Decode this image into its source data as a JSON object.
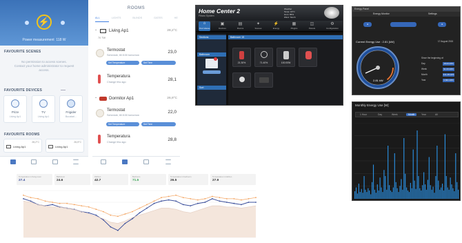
{
  "phone_home": {
    "power_label": "Power measurement",
    "power_value": "118 W",
    "favourite_scenes": "FAVOURITE SCENES",
    "no_permission_1": "No permission to access scenes.",
    "no_permission_2": "Contact your home administrator to request",
    "no_permission_3": "access.",
    "favourite_devices": "FAVOURITE DEVICES",
    "devices": [
      {
        "name": "Prize",
        "room": "Living Ap1"
      },
      {
        "name": "TV",
        "room": "Living Ap1"
      },
      {
        "name": "Frigider",
        "room": "Bucatari..."
      }
    ],
    "favourite_rooms": "FAVOURITE ROOMS",
    "rooms": [
      {
        "name": "Living Ap1",
        "temp": "28,2°C"
      },
      {
        "name": "Living Ap1",
        "temp": "26,5°C"
      }
    ]
  },
  "phone_rooms": {
    "title": "ROOMS",
    "tabs": [
      "ALL",
      "LIGHTS",
      "BLINDS",
      "GATES",
      "HE"
    ],
    "room1": {
      "name": "Living Ap1",
      "temp": "28,2°C",
      "power": "70 TW"
    },
    "device1": {
      "name": "Termostat",
      "sub": "Schedule, till 8:00 tomorrow",
      "value": "23,0",
      "btn1": "Set Temperature",
      "btn2": "Set Time"
    },
    "device2": {
      "name": "Temperatura",
      "sub": "Change few ago",
      "value": "28,1"
    },
    "room2": {
      "name": "Dormitor Ap1",
      "temp": "26,9°C"
    },
    "device3": {
      "name": "Termostat",
      "sub": "Schedule, till 8:00 tomorrow",
      "value": "22,0",
      "btn1": "Set Temperature",
      "btn2": "Set Time"
    },
    "device4": {
      "name": "Temperatura",
      "sub": "Change few ago",
      "value": "28,8"
    }
  },
  "home_center": {
    "title": "Home Center 2",
    "subtitle": "Fibaro System",
    "weather": [
      "Weather",
      "Temp: 16°C",
      "Hum: 86%",
      "Wind: 7km/h"
    ],
    "nav": [
      "Your House",
      "Devices",
      "Rooms",
      "Scenes",
      "Energy",
      "Plugins",
      "Panels",
      "Configuration"
    ],
    "left_items": [
      "Sections",
      "Bathroom",
      "Sort"
    ],
    "section_title": "Bathroom 15",
    "tiles": [
      {
        "label": "21.30%"
      },
      {
        "label": "71.40%"
      },
      {
        "label": "100.00W"
      },
      {
        "label": ""
      },
      {
        "label": ""
      },
      {
        "label": ""
      }
    ]
  },
  "energy": {
    "header": "Energy Panel",
    "tabs": [
      "Energy Monitor",
      "Settings"
    ],
    "current_label": "Current Energy Use : 2.81 [kW]",
    "date": "17 August 2015",
    "since_label": "Since the beginning of:",
    "rows": [
      {
        "name": "Day",
        "value": "18.03 kWh"
      },
      {
        "name": "Week",
        "value": "91.63 kWh"
      },
      {
        "name": "Month",
        "value": "311.28 kWh"
      },
      {
        "name": "Year",
        "value": "2,601 kWh"
      }
    ],
    "gauge_value": "2.81",
    "gauge_unit": "kW"
  },
  "monthly": {
    "title": "Monthly Energy Use [W]",
    "tabs": [
      "1 Hour",
      "Day",
      "Week",
      "Month",
      "Year",
      "All"
    ],
    "active_tab": "Month"
  },
  "line_chart": {
    "stats": [
      {
        "name": "Temperature in living room",
        "value": "27.4"
      },
      {
        "name": "Bathroom",
        "value": "24.6"
      },
      {
        "name": "Kitchen",
        "value": "42.7"
      },
      {
        "name": "Bedroom",
        "value": "71.5"
      },
      {
        "name": "Temperature in bedroom",
        "value": "26.5"
      },
      {
        "name": "Temperature in kitchen",
        "value": "27.9"
      }
    ]
  },
  "chart_data": [
    {
      "type": "line",
      "series": [
        {
          "values": [
            33,
            31,
            28,
            27,
            28,
            26,
            25,
            24,
            22,
            21,
            19,
            15,
            9,
            6,
            12,
            16,
            21,
            25,
            29,
            31,
            32,
            31,
            28,
            27,
            29,
            30,
            33,
            31,
            30,
            29,
            28,
            30,
            30
          ]
        },
        {
          "values": [
            36,
            34,
            33,
            31,
            30,
            29,
            29,
            28,
            27,
            26,
            24,
            22,
            19,
            18,
            20,
            22,
            25,
            28,
            31,
            34,
            35,
            36,
            34,
            33,
            32,
            33,
            35,
            34,
            33,
            33,
            32,
            33,
            34
          ]
        },
        {
          "values": [
            31,
            30,
            28,
            27,
            26,
            26,
            25,
            24,
            22,
            20,
            18,
            16,
            13,
            12,
            14,
            17,
            19,
            21,
            23,
            25,
            25,
            24,
            22,
            21,
            23,
            25,
            27,
            27,
            26,
            26,
            25,
            26,
            27
          ]
        }
      ],
      "ylim": [
        0,
        40
      ],
      "colors": [
        "#3b4f9b",
        "#f4a460",
        "#e5cfc3"
      ]
    },
    {
      "type": "bar",
      "values": [
        10,
        15,
        7,
        20,
        9,
        13,
        8,
        30,
        12,
        9,
        14,
        11,
        6,
        22,
        45,
        12,
        8,
        19,
        11,
        28,
        15,
        9,
        38,
        30,
        12,
        70,
        18,
        11,
        9,
        15,
        60,
        22,
        14,
        9,
        17,
        26,
        12,
        80,
        33,
        15,
        11,
        9,
        21,
        14,
        65,
        24,
        13,
        90,
        30,
        14,
        11,
        18,
        35,
        19,
        12,
        25,
        55,
        18,
        12,
        16,
        8,
        30,
        70,
        24,
        12,
        15,
        20,
        11,
        85,
        30,
        15,
        12,
        28,
        19,
        14,
        10,
        60,
        22,
        12
      ]
    }
  ]
}
